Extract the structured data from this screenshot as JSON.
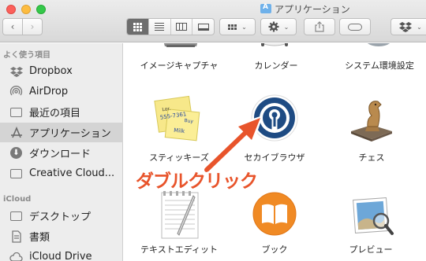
{
  "window": {
    "title": "アプリケーション",
    "title_icon": "applications-folder-icon"
  },
  "toolbar": {
    "back_icon": "chevron-left-icon",
    "forward_icon": "chevron-right-icon",
    "back_glyph": "‹",
    "forward_glyph": "›",
    "chevron_glyph": "⌄",
    "view_modes": [
      "icon",
      "list",
      "column",
      "gallery"
    ],
    "active_view": "icon"
  },
  "sidebar": {
    "favorites_header": "よく使う項目",
    "icloud_header": "iCloud",
    "favorites": [
      {
        "label": "Dropbox",
        "icon": "dropbox-icon"
      },
      {
        "label": "AirDrop",
        "icon": "airdrop-icon"
      },
      {
        "label": "最近の項目",
        "icon": "recents-icon"
      },
      {
        "label": "アプリケーション",
        "icon": "applications-icon",
        "selected": true
      },
      {
        "label": "ダウンロード",
        "icon": "downloads-icon"
      },
      {
        "label": "Creative Cloud...",
        "icon": "folder-icon"
      }
    ],
    "icloud": [
      {
        "label": "デスクトップ",
        "icon": "desktop-folder-icon"
      },
      {
        "label": "書類",
        "icon": "documents-icon"
      },
      {
        "label": "iCloud Drive",
        "icon": "icloud-drive-icon"
      }
    ]
  },
  "content": {
    "row1": [
      "イメージキャプチャ",
      "カレンダー",
      "システム環境設定"
    ],
    "row2": [
      "スティッキーズ",
      "セカイブラウザ",
      "チェス"
    ],
    "row3": [
      "テキストエディット",
      "ブック",
      "プレビュー"
    ],
    "sticky_note_text": [
      "Lor.",
      "555-7361",
      "Buy",
      "Milk"
    ]
  },
  "annotation": {
    "text": "ダブルクリック",
    "color": "#e8542b"
  },
  "colors": {
    "selection": "#d4d4d4",
    "sidebar_bg": "#ededed",
    "accent_arrow": "#e8542b"
  }
}
